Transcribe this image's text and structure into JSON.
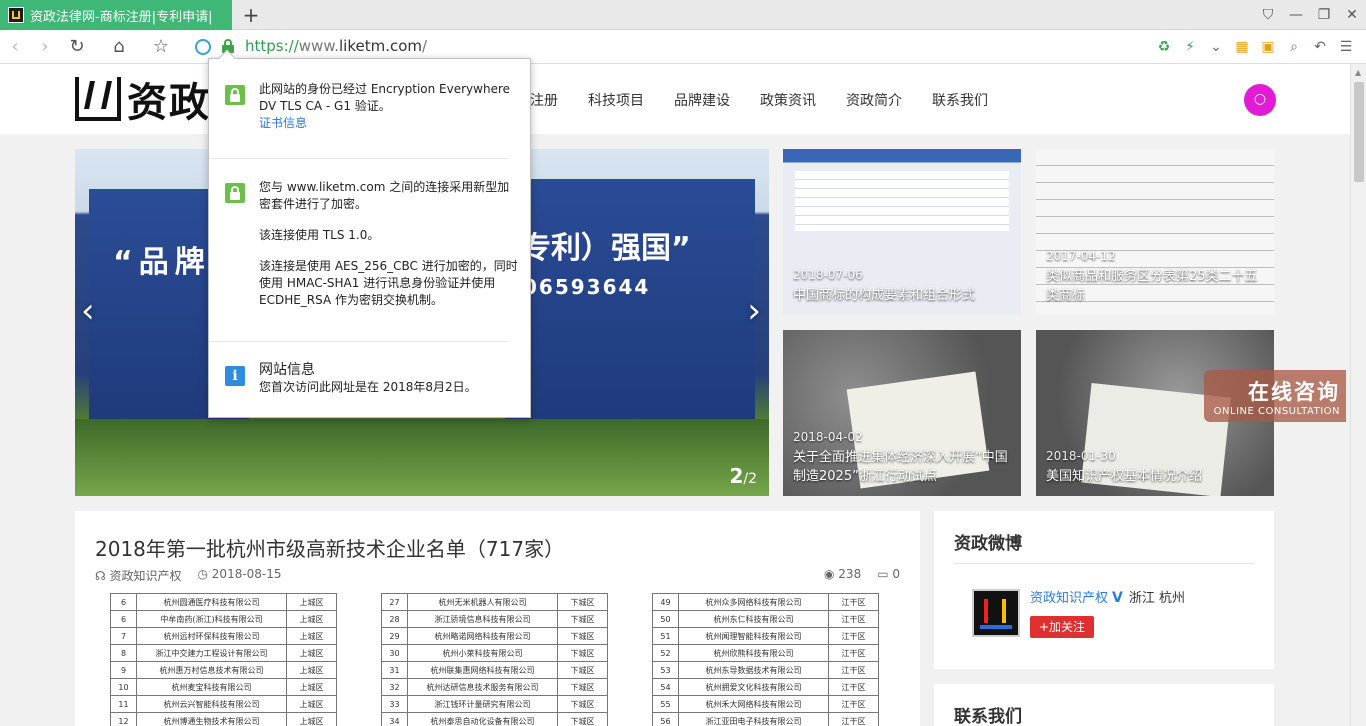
{
  "browser": {
    "tab_title": "资政法律网-商标注册|专利申请|",
    "new_tab": "+",
    "url_scheme": "https://",
    "url_host_prefix": "www.",
    "url_host": "liketm.com",
    "url_path": "/"
  },
  "site": {
    "logo_text": "资政",
    "menu": [
      "注册",
      "科技项目",
      "品牌建设",
      "政策资讯",
      "资政简介",
      "联系我们"
    ]
  },
  "slider": {
    "banner_left_text": "“品牌",
    "banner_right_text": "专利）强国”",
    "banner_phone": "06593644",
    "counter_current": "2",
    "counter_total": "/2"
  },
  "thumbs": [
    {
      "date": "2018-07-06",
      "title": "中国商标的构成要素和组合形式"
    },
    {
      "date": "2017-04-12",
      "title": "类似商品和服务区分表第25类二十五类商标"
    },
    {
      "date": "2018-04-02",
      "title": "关于全面推进集体经济深入开展“中国制造2025”浙江行动试点"
    },
    {
      "date": "2018-01-30",
      "title": "美国知识产权基本情况介绍"
    }
  ],
  "consult": {
    "big": "在线咨询",
    "small": "ONLINE CONSULTATION"
  },
  "article": {
    "title": "2018年第一批杭州市级高新技术企业名单（717家）",
    "author": "资政知识产权",
    "date": "2018-08-15",
    "views": "238",
    "comments": "0"
  },
  "table_cols": [
    {
      "rows": [
        [
          "6",
          "杭州圆通医疗科技有限公司",
          "上城区"
        ],
        [
          "6",
          "中牟南药(浙江)科技有限公司",
          "上城区"
        ],
        [
          "7",
          "杭州远村环保科技有限公司",
          "上城区"
        ],
        [
          "8",
          "浙江中交建力工程设计有限公司",
          "上城区"
        ],
        [
          "9",
          "杭州惠万村信息技术有限公司",
          "上城区"
        ],
        [
          "10",
          "杭州麦宝科技有限公司",
          "上城区"
        ],
        [
          "11",
          "杭州云兴智能科技有限公司",
          "上城区"
        ],
        [
          "12",
          "杭州博通生物技术有限公司",
          "上城区"
        ]
      ]
    },
    {
      "rows": [
        [
          "27",
          "杭州无米机器人有限公司",
          "下城区"
        ],
        [
          "28",
          "浙江骄境信息科技有限公司",
          "下城区"
        ],
        [
          "29",
          "杭州略诺网络科技有限公司",
          "下城区"
        ],
        [
          "30",
          "杭州小莱科技有限公司",
          "下城区"
        ],
        [
          "31",
          "杭州联集惠网络科技有限公司",
          "下城区"
        ],
        [
          "32",
          "杭州达研信息技术服务有限公司",
          "下城区"
        ],
        [
          "33",
          "浙江钱环计量研究有限公司",
          "下城区"
        ],
        [
          "34",
          "杭州泰思自动化设备有限公司",
          "下城区"
        ]
      ]
    },
    {
      "rows": [
        [
          "49",
          "杭州众多网络科技有限公司",
          "江干区"
        ],
        [
          "50",
          "杭州东仁科技有限公司",
          "江干区"
        ],
        [
          "51",
          "杭州闻理智能科技有限公司",
          "江干区"
        ],
        [
          "52",
          "杭州欣熊科技有限公司",
          "江干区"
        ],
        [
          "53",
          "杭州东导数据技术有限公司",
          "江干区"
        ],
        [
          "54",
          "杭州拥爱文化科技有限公司",
          "江干区"
        ],
        [
          "55",
          "杭州禾大网络科技有限公司",
          "江干区"
        ],
        [
          "56",
          "浙江亚田电子科技有限公司",
          "江干区"
        ]
      ]
    }
  ],
  "sidebar": {
    "weibo_title": "资政微博",
    "weibo_name": "资政知识产权",
    "weibo_v": "V",
    "weibo_location": "浙江 杭州",
    "follow_label": "+加关注",
    "contact_title": "联系我们"
  },
  "popup": {
    "identity_text": "此网站的身份已经过 Encryption Everywhere DV TLS CA - G1 验证。",
    "cert_link": "证书信息",
    "conn_text": "您与 www.liketm.com 之间的连接采用新型加密套件进行了加密。",
    "tls_text": "该连接使用 TLS 1.0。",
    "cipher_text": "该连接是使用 AES_256_CBC 进行加密的，同时使用 HMAC-SHA1 进行讯息身份验证并使用 ECDHE_RSA 作为密钥交换机制。",
    "site_info_title": "网站信息",
    "site_info_text": "您首次访问此网址是在 2018年8月2日。"
  }
}
